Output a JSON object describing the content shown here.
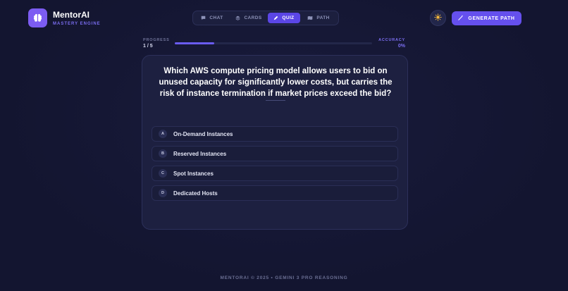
{
  "brand": {
    "name": "MentorAI",
    "subtitle": "MASTERY ENGINE"
  },
  "nav": {
    "tabs": [
      {
        "label": "CHAT",
        "icon": "chat-icon",
        "active": false
      },
      {
        "label": "CARDS",
        "icon": "stack-icon",
        "active": false
      },
      {
        "label": "QUIZ",
        "icon": "pencil-icon",
        "active": true
      },
      {
        "label": "PATH",
        "icon": "map-icon",
        "active": false
      }
    ]
  },
  "header": {
    "theme_icon": "sun-icon",
    "generate_label": "GENERATE PATH",
    "generate_icon": "magic-wand-icon"
  },
  "progress": {
    "label": "PROGRESS",
    "value": "1 / 5",
    "fraction": 0.2
  },
  "accuracy": {
    "label": "ACCURACY",
    "value": "0%"
  },
  "quiz": {
    "question": "Which AWS compute pricing model allows users to bid on unused capacity for significantly lower costs, but carries the risk of instance termination if market prices exceed the bid?",
    "options": [
      {
        "letter": "A",
        "text": "On-Demand Instances"
      },
      {
        "letter": "B",
        "text": "Reserved Instances"
      },
      {
        "letter": "C",
        "text": "Spot Instances"
      },
      {
        "letter": "D",
        "text": "Dedicated Hosts"
      }
    ]
  },
  "footer": {
    "text": "MENTORAI © 2025 • GEMINI 3 PRO REASONING"
  },
  "colors": {
    "accent": "#6550ee",
    "background": "#141631",
    "card": "#1d2040"
  }
}
